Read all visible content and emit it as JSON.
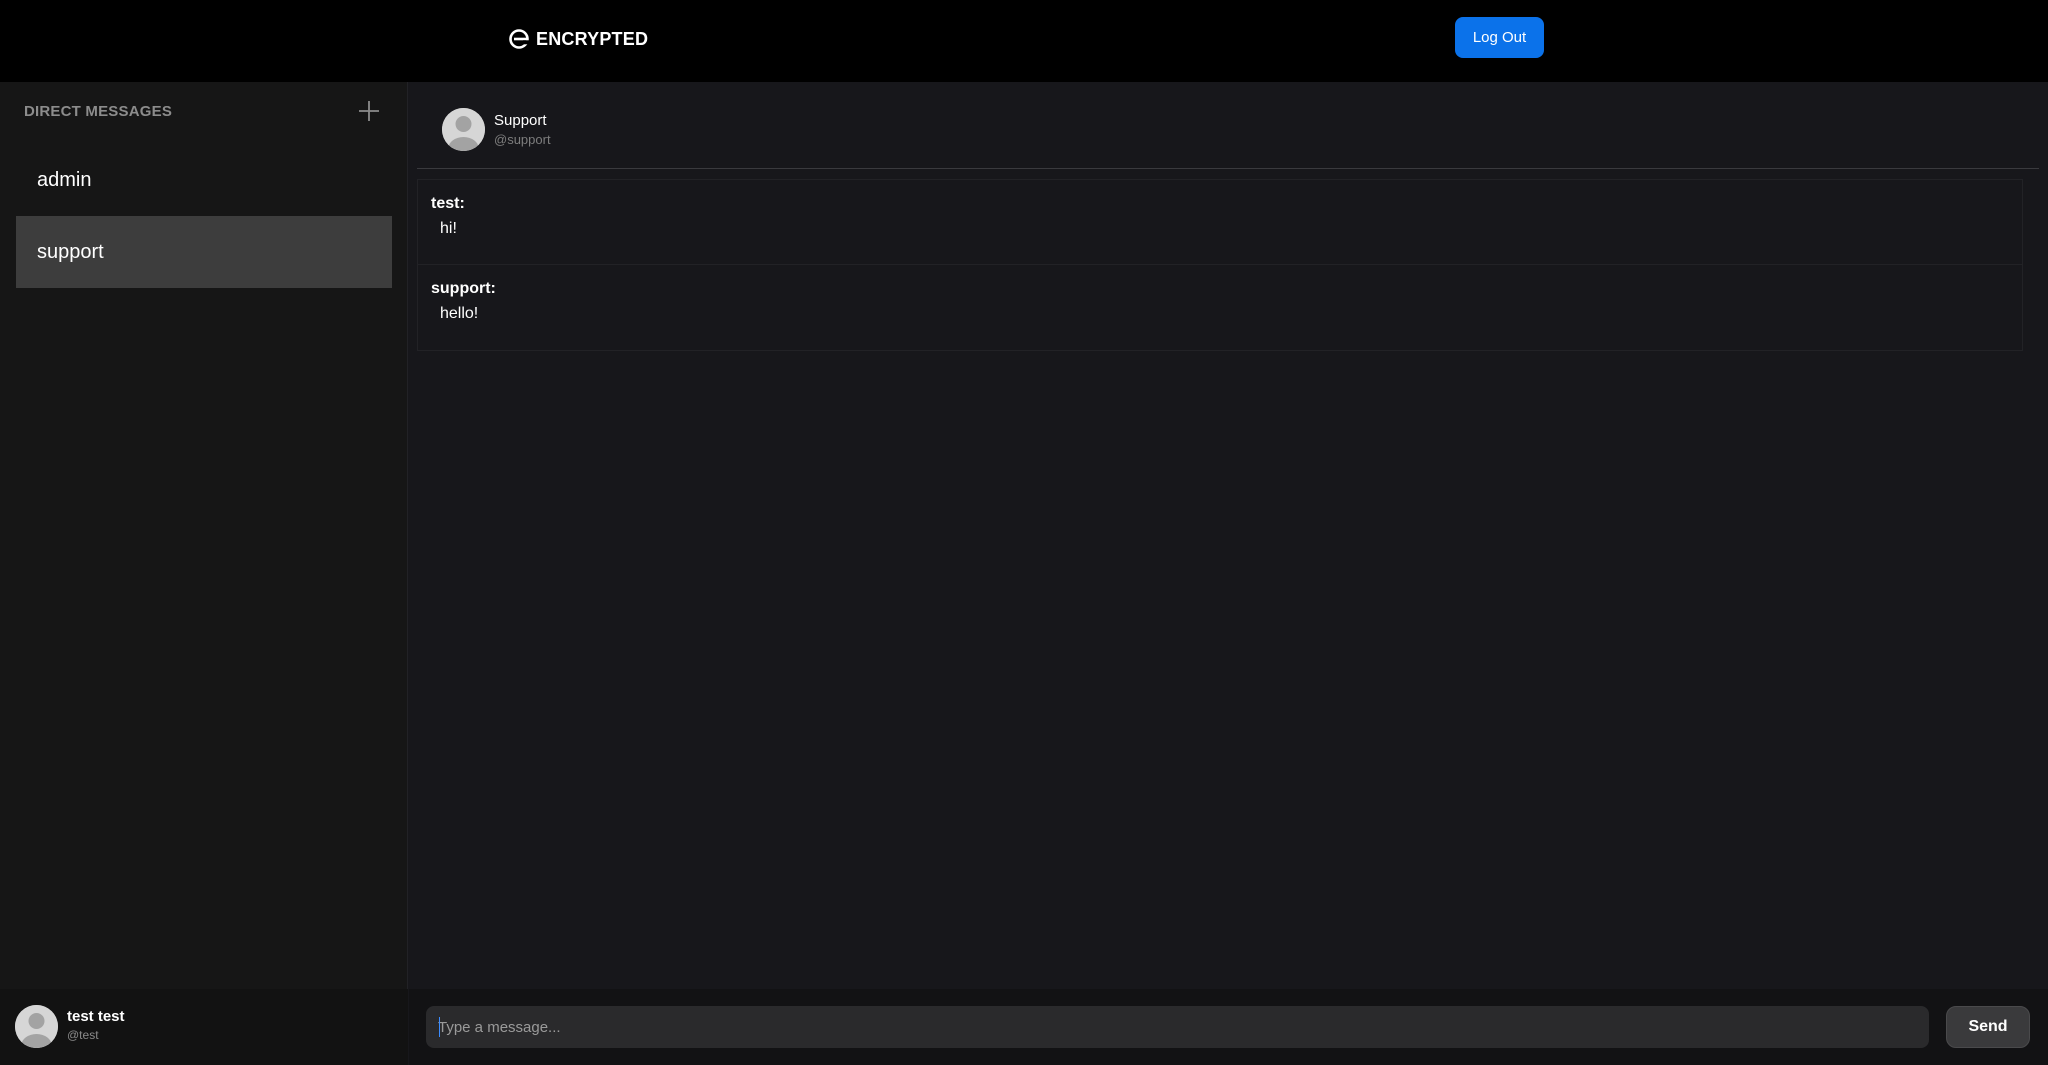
{
  "header": {
    "brand": "ENCRYPTED",
    "logout_label": "Log Out"
  },
  "sidebar": {
    "title": "DIRECT MESSAGES",
    "items": [
      {
        "label": "admin",
        "active": false
      },
      {
        "label": "support",
        "active": true
      }
    ],
    "current_user": {
      "name": "test test",
      "handle": "@test"
    }
  },
  "chat": {
    "contact": {
      "name": "Support",
      "handle": "@support"
    },
    "messages": [
      {
        "sender": "test:",
        "text": "hi!"
      },
      {
        "sender": "support:",
        "text": "hello!"
      }
    ],
    "composer": {
      "placeholder": "Type a message...",
      "value": "",
      "send_label": "Send"
    }
  },
  "colors": {
    "accent": "#0b72ea",
    "topbar": "#000000",
    "sidebar": "#161616",
    "chat_bg": "#17171b",
    "active_item": "#3d3d3d"
  }
}
